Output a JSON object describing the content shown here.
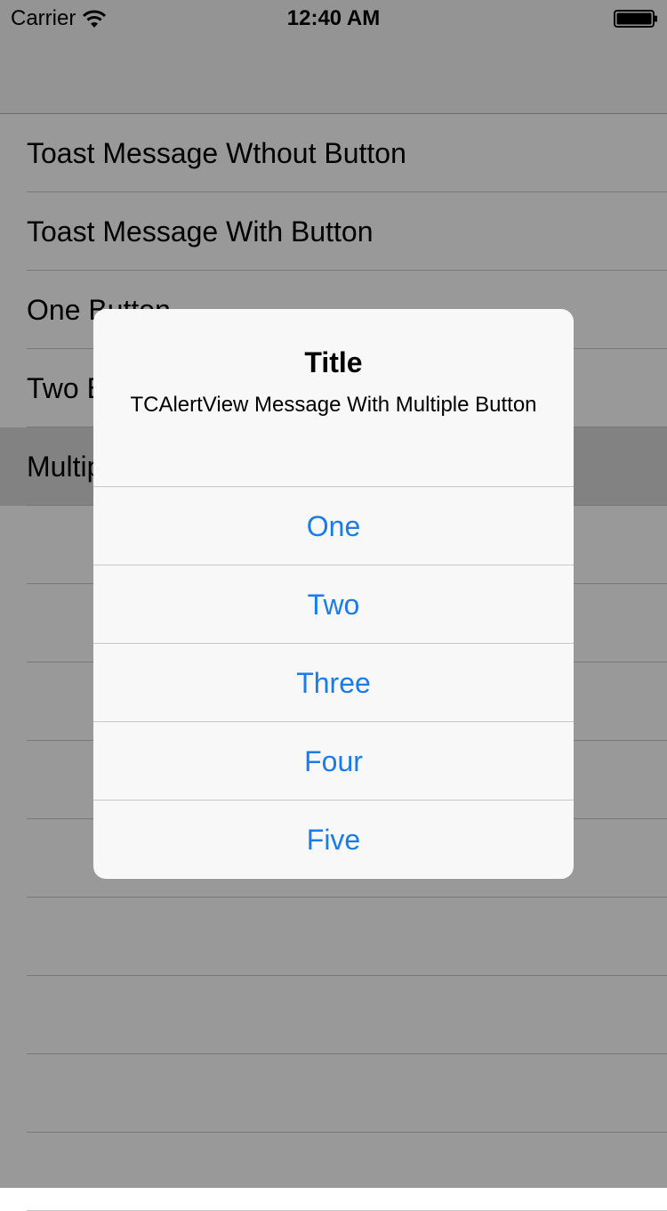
{
  "status_bar": {
    "carrier": "Carrier",
    "time": "12:40 AM",
    "wifi_icon": "wifi-icon",
    "battery_icon": "battery-icon"
  },
  "table": {
    "rows": [
      {
        "label": "Toast Message Wthout Button"
      },
      {
        "label": "Toast Message With Button"
      },
      {
        "label": "One Button"
      },
      {
        "label": "Two Button"
      },
      {
        "label": "Multiple Button"
      }
    ]
  },
  "alert": {
    "title": "Title",
    "message": "TCAlertView Message With Multiple Button",
    "buttons": [
      "One",
      "Two",
      "Three",
      "Four",
      "Five"
    ]
  },
  "colors": {
    "button_text": "#1a7ce8",
    "separator": "#c8c7cc",
    "overlay": "rgba(0,0,0,0.4)"
  }
}
